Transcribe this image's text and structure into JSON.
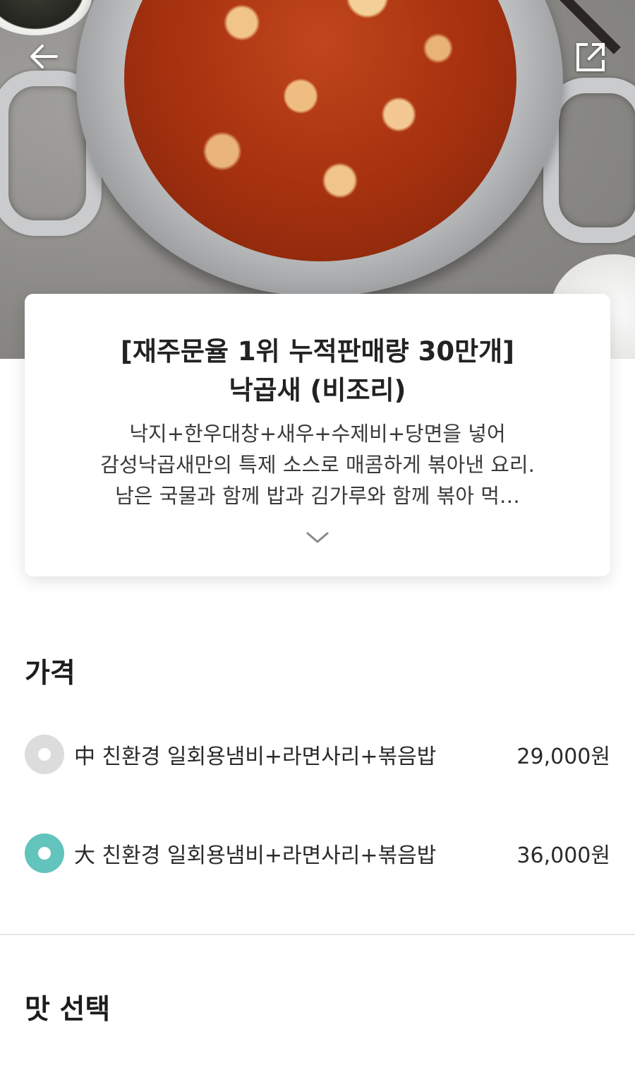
{
  "product": {
    "title_line1": "[재주문율 1위 누적판매량 30만개]",
    "title_line2": "낙곱새 (비조리)",
    "description_line1": "낙지+한우대창+새우+수제비+당면을 넣어",
    "description_line2": "감성낙곱새만의 특제 소스로 매콤하게 볶아낸 요리.",
    "description_line3": "남은 국물과 함께 밥과 김가루와 함께 볶아 먹…"
  },
  "price_section": {
    "heading": "가격",
    "options": [
      {
        "label": "中 친환경 일회용냄비+라면사리+볶음밥",
        "price": "29,000원",
        "selected": false
      },
      {
        "label": "大 친환경 일회용냄비+라면사리+볶음밥",
        "price": "36,000원",
        "selected": true
      }
    ]
  },
  "taste_section": {
    "heading": "맛 선택"
  },
  "icons": {
    "back": "back-arrow-icon",
    "share": "share-external-icon",
    "expand": "chevron-down-icon"
  },
  "colors": {
    "accent": "#63c3bd",
    "radio_unselected": "#dcdcdc"
  }
}
